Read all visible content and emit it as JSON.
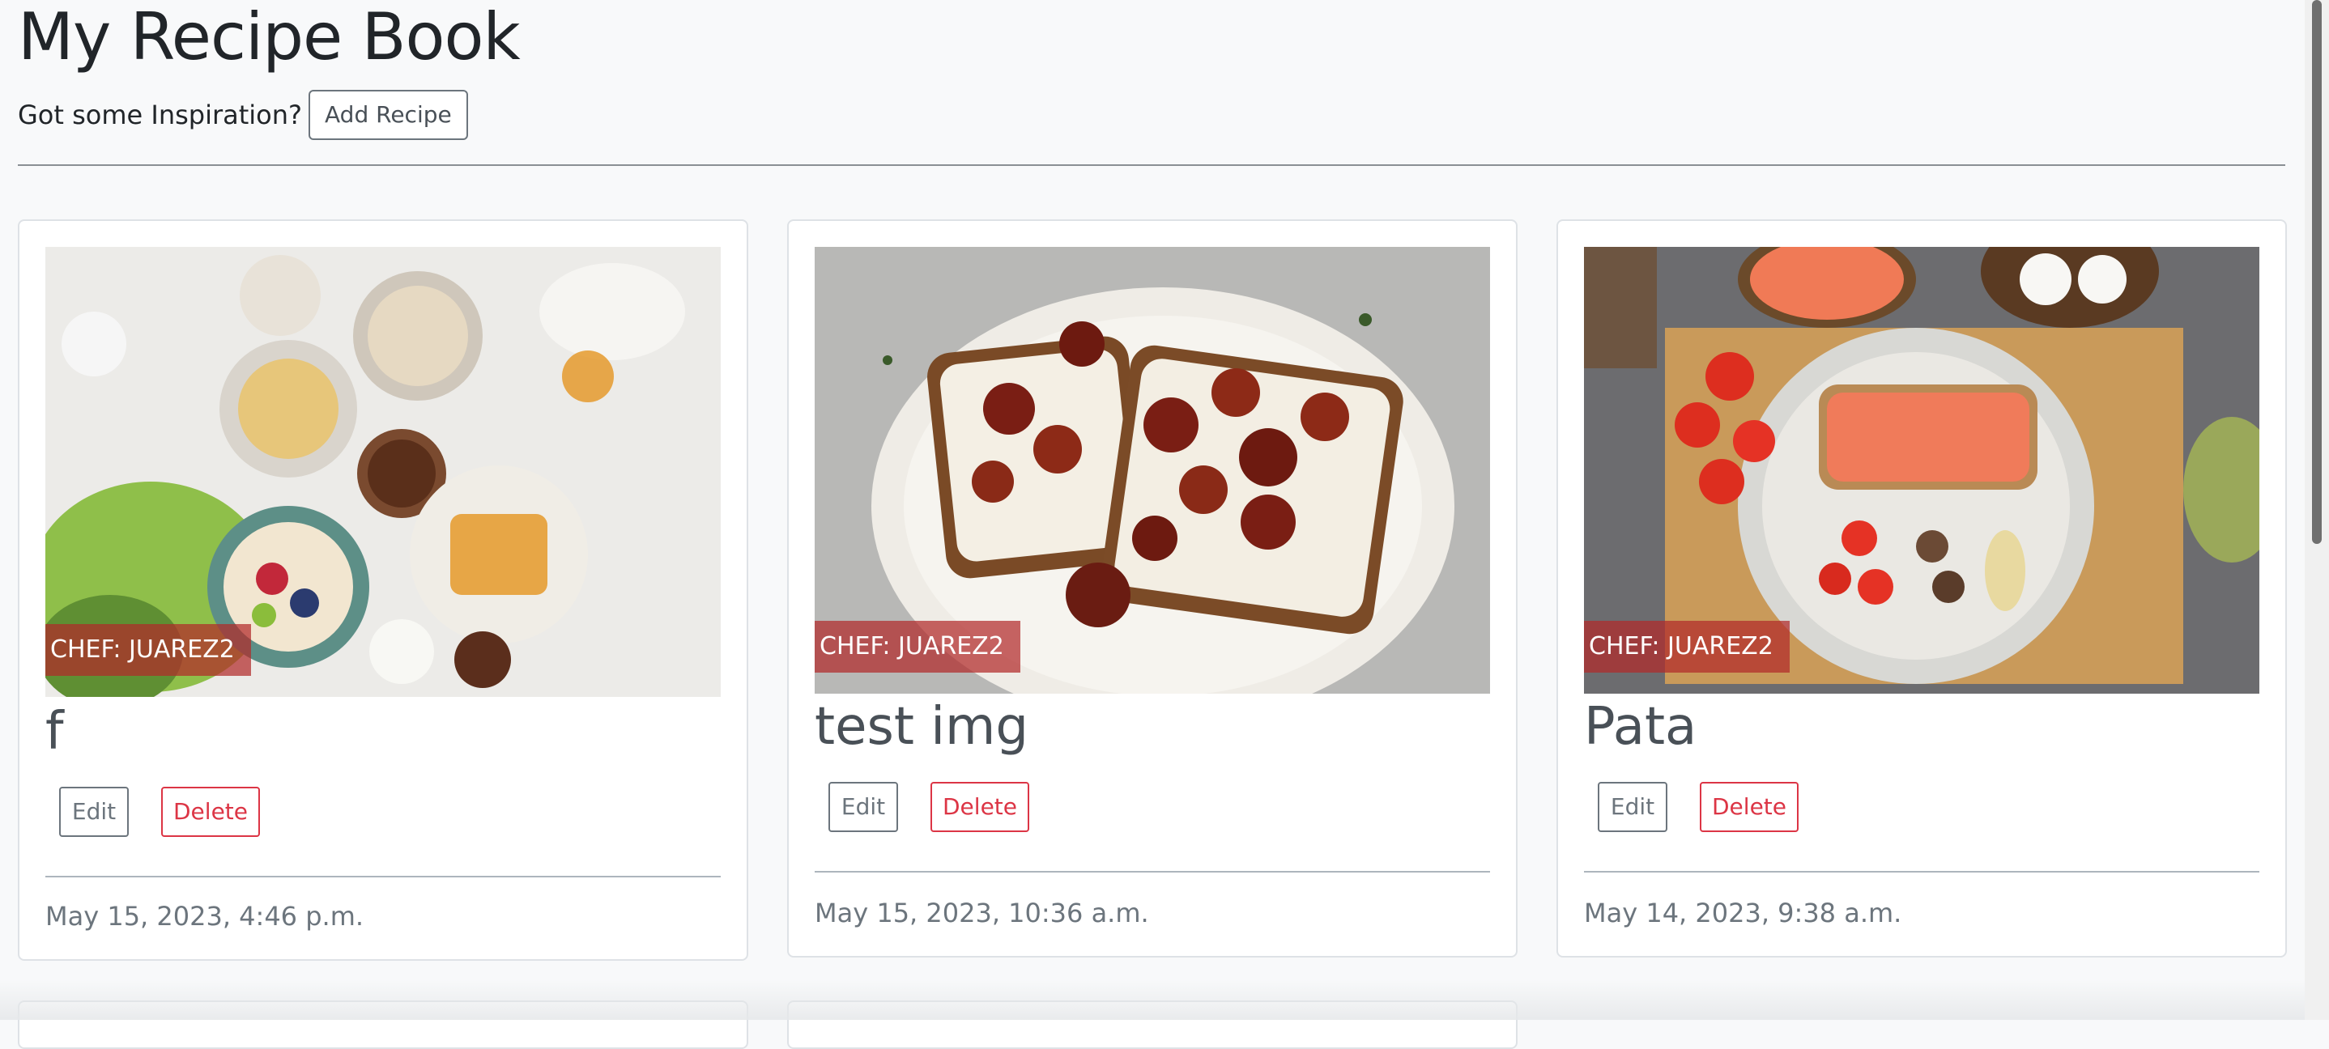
{
  "header": {
    "title": "My Recipe Book",
    "tagline": "Got some Inspiration?",
    "add_recipe_label": "Add Recipe"
  },
  "recipes": [
    {
      "chef": "CHEF: JUAREZ2",
      "title": "f",
      "edit_label": "Edit",
      "delete_label": "Delete",
      "date": "May 15, 2023, 4:46 p.m."
    },
    {
      "chef": "CHEF: JUAREZ2",
      "title": "test img",
      "edit_label": "Edit",
      "delete_label": "Delete",
      "date": "May 15, 2023, 10:36 a.m."
    },
    {
      "chef": "CHEF: JUAREZ2",
      "title": "Pata",
      "edit_label": "Edit",
      "delete_label": "Delete",
      "date": "May 14, 2023, 9:38 a.m."
    }
  ],
  "colors": {
    "danger": "#dc3545",
    "secondary": "#6c757d",
    "badge": "#b22a2a"
  }
}
